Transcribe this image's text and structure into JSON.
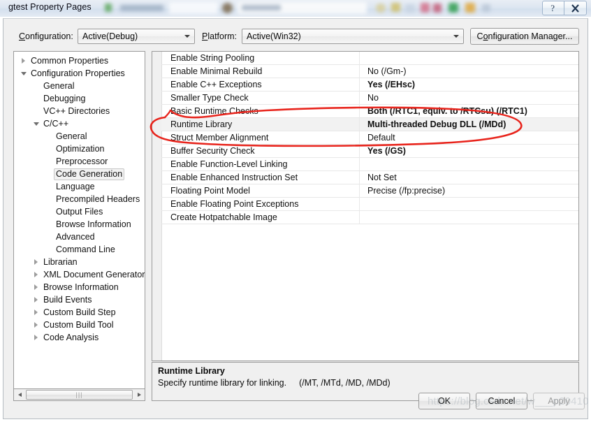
{
  "window": {
    "title": "gtest Property Pages",
    "help_button": "?",
    "close_button": "✕"
  },
  "toolbar": {
    "configuration_label": "Configuration:",
    "configuration_value": "Active(Debug)",
    "platform_label": "Platform:",
    "platform_value": "Active(Win32)",
    "configuration_manager_label": "Configuration Manager..."
  },
  "tree": {
    "items": [
      {
        "label": "Common Properties",
        "indent": 0,
        "state": "collapsed",
        "selected": false
      },
      {
        "label": "Configuration Properties",
        "indent": 0,
        "state": "expanded",
        "selected": false
      },
      {
        "label": "General",
        "indent": 1,
        "state": "leaf",
        "selected": false
      },
      {
        "label": "Debugging",
        "indent": 1,
        "state": "leaf",
        "selected": false
      },
      {
        "label": "VC++ Directories",
        "indent": 1,
        "state": "leaf",
        "selected": false
      },
      {
        "label": "C/C++",
        "indent": 1,
        "state": "expanded",
        "selected": false
      },
      {
        "label": "General",
        "indent": 2,
        "state": "leaf",
        "selected": false
      },
      {
        "label": "Optimization",
        "indent": 2,
        "state": "leaf",
        "selected": false
      },
      {
        "label": "Preprocessor",
        "indent": 2,
        "state": "leaf",
        "selected": false
      },
      {
        "label": "Code Generation",
        "indent": 2,
        "state": "leaf",
        "selected": true
      },
      {
        "label": "Language",
        "indent": 2,
        "state": "leaf",
        "selected": false
      },
      {
        "label": "Precompiled Headers",
        "indent": 2,
        "state": "leaf",
        "selected": false
      },
      {
        "label": "Output Files",
        "indent": 2,
        "state": "leaf",
        "selected": false
      },
      {
        "label": "Browse Information",
        "indent": 2,
        "state": "leaf",
        "selected": false
      },
      {
        "label": "Advanced",
        "indent": 2,
        "state": "leaf",
        "selected": false
      },
      {
        "label": "Command Line",
        "indent": 2,
        "state": "leaf",
        "selected": false
      },
      {
        "label": "Librarian",
        "indent": 1,
        "state": "collapsed",
        "selected": false
      },
      {
        "label": "XML Document Generator",
        "indent": 1,
        "state": "collapsed",
        "selected": false
      },
      {
        "label": "Browse Information",
        "indent": 1,
        "state": "collapsed",
        "selected": false
      },
      {
        "label": "Build Events",
        "indent": 1,
        "state": "collapsed",
        "selected": false
      },
      {
        "label": "Custom Build Step",
        "indent": 1,
        "state": "collapsed",
        "selected": false
      },
      {
        "label": "Custom Build Tool",
        "indent": 1,
        "state": "collapsed",
        "selected": false
      },
      {
        "label": "Code Analysis",
        "indent": 1,
        "state": "collapsed",
        "selected": false
      }
    ]
  },
  "grid": {
    "rows": [
      {
        "name": "Enable String Pooling",
        "value": "",
        "bold": false,
        "selected": false
      },
      {
        "name": "Enable Minimal Rebuild",
        "value": "No (/Gm-)",
        "bold": false,
        "selected": false
      },
      {
        "name": "Enable C++ Exceptions",
        "value": "Yes (/EHsc)",
        "bold": true,
        "selected": false
      },
      {
        "name": "Smaller Type Check",
        "value": "No",
        "bold": false,
        "selected": false
      },
      {
        "name": "Basic Runtime Checks",
        "value": "Both (/RTC1, equiv. to /RTCsu) (/RTC1)",
        "bold": true,
        "selected": false
      },
      {
        "name": "Runtime Library",
        "value": "Multi-threaded Debug DLL (/MDd)",
        "bold": true,
        "selected": true
      },
      {
        "name": "Struct Member Alignment",
        "value": "Default",
        "bold": false,
        "selected": false
      },
      {
        "name": "Buffer Security Check",
        "value": "Yes (/GS)",
        "bold": true,
        "selected": false
      },
      {
        "name": "Enable Function-Level Linking",
        "value": "",
        "bold": false,
        "selected": false
      },
      {
        "name": "Enable Enhanced Instruction Set",
        "value": "Not Set",
        "bold": false,
        "selected": false
      },
      {
        "name": "Floating Point Model",
        "value": "Precise (/fp:precise)",
        "bold": false,
        "selected": false
      },
      {
        "name": "Enable Floating Point Exceptions",
        "value": "",
        "bold": false,
        "selected": false
      },
      {
        "name": "Create Hotpatchable Image",
        "value": "",
        "bold": false,
        "selected": false
      }
    ]
  },
  "description": {
    "title": "Runtime Library",
    "text": "Specify runtime library for linking.",
    "switches": "(/MT, /MTd, /MD, /MDd)"
  },
  "footer": {
    "ok_label": "OK",
    "cancel_label": "Cancel",
    "apply_label": "Apply"
  },
  "annotation": {
    "color": "#e8241c",
    "target": "Runtime Library"
  },
  "watermark": {
    "text": "https://blog.csdn.net/w___p20410"
  }
}
